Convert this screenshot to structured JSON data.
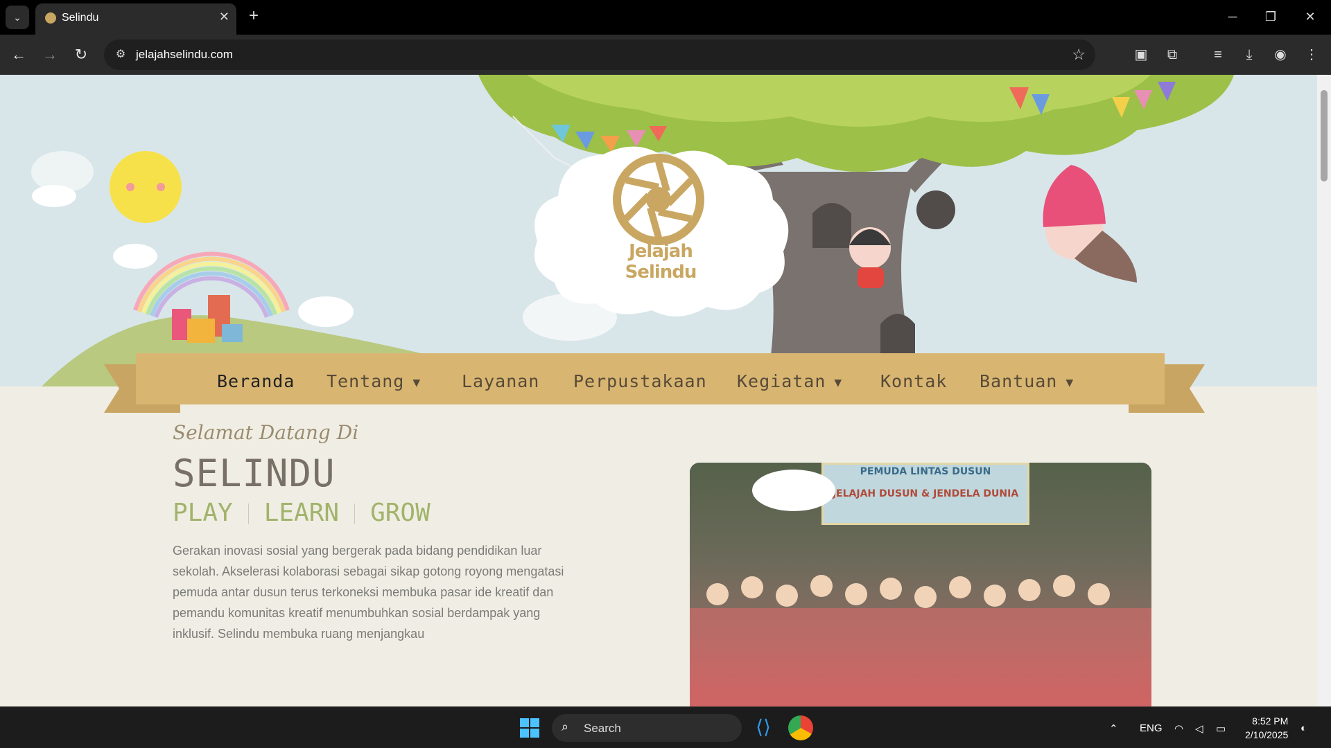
{
  "browser": {
    "tab_title": "Selindu",
    "url": "jelajahselindu.com"
  },
  "site": {
    "logo_text": "Jelajah Selindu",
    "nav": [
      {
        "label": "Beranda",
        "dropdown": false
      },
      {
        "label": "Tentang",
        "dropdown": true
      },
      {
        "label": "Layanan",
        "dropdown": false
      },
      {
        "label": "Perpustakaan",
        "dropdown": false
      },
      {
        "label": "Kegiatan",
        "dropdown": true
      },
      {
        "label": "Kontak",
        "dropdown": false
      },
      {
        "label": "Bantuan",
        "dropdown": true
      }
    ],
    "welcome": "Selamat Datang Di",
    "brand": "SELINDU",
    "tagline": [
      "PLAY",
      "LEARN",
      "GROW"
    ],
    "description": "Gerakan inovasi sosial yang bergerak pada bidang pendidikan luar sekolah. Akselerasi kolaborasi sebagai sikap gotong royong mengatasi pemuda antar dusun terus terkoneksi membuka pasar ide kreatif dan pemandu komunitas kreatif  menumbuhkan sosial berdampak yang inklusif. Selindu membuka ruang menjangkau",
    "photo_banner": {
      "line1": "PEMUDA LINTAS DUSUN",
      "line2": "JELAJAH DUSUN & JENDELA DUNIA"
    }
  },
  "taskbar": {
    "search_placeholder": "Search",
    "language": "ENG",
    "time": "8:52 PM",
    "date": "2/10/2025"
  },
  "colors": {
    "ribbon": "#d8b672",
    "sky": "#d8e6ea",
    "page_bg": "#f0eee4",
    "tagline": "#a1b36b"
  }
}
